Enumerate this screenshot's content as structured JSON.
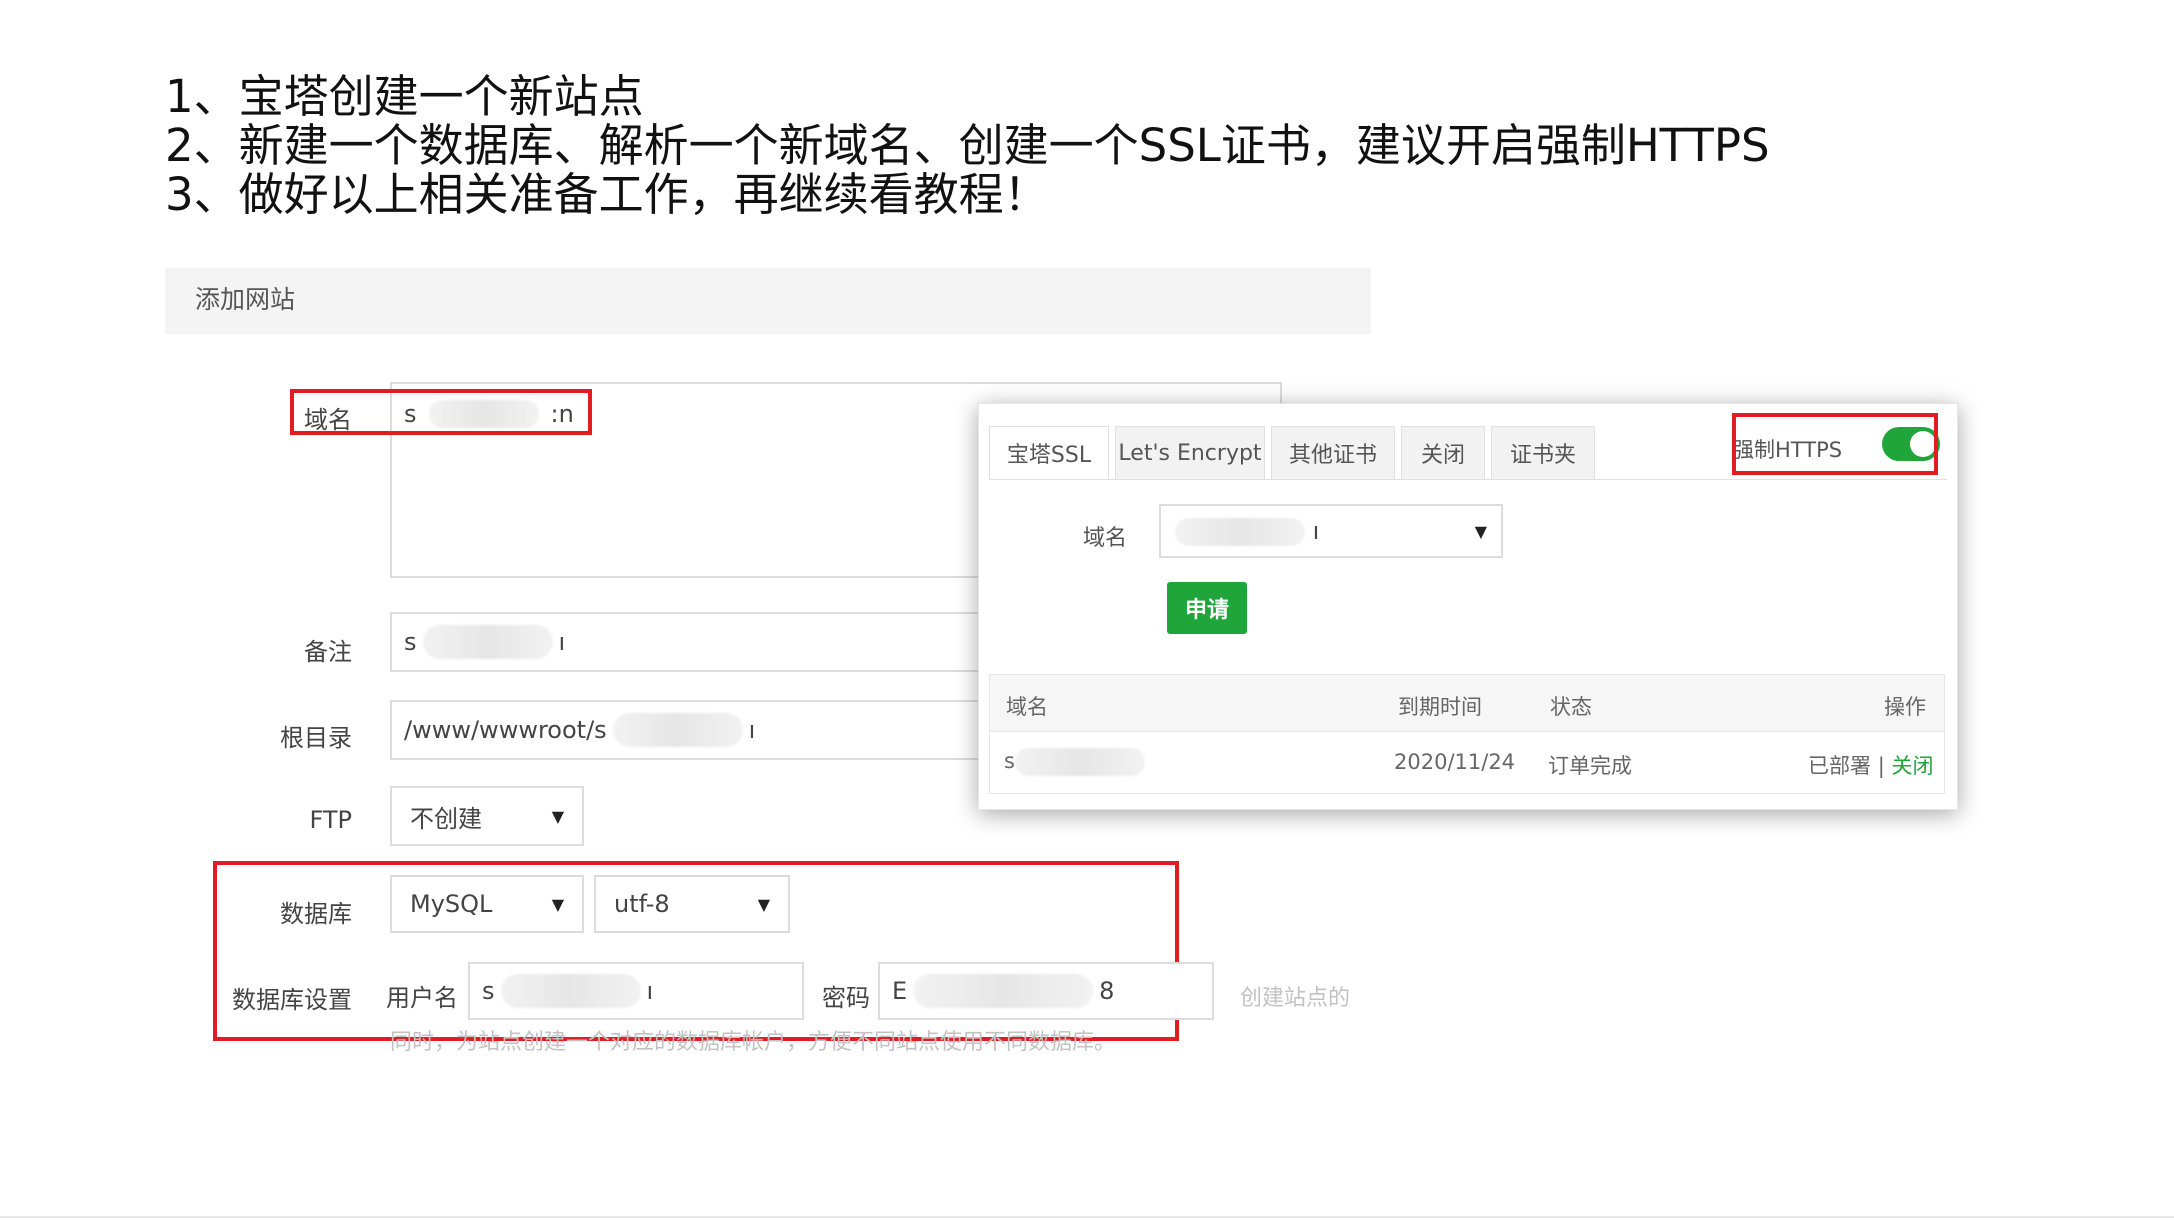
{
  "instructions": {
    "line1": "1、宝塔创建一个新站点",
    "line2": "2、新建一个数据库、解析一个新域名、创建一个SSL证书，建议开启强制HTTPS",
    "line3": "3、做好以上相关准备工作，再继续看教程！"
  },
  "add_site": {
    "title": "添加网站",
    "domain_label": "域名",
    "domain_value_start": "s",
    "domain_value_end": ":n",
    "remark_label": "备注",
    "remark_value_start": "s",
    "remark_value_end": "ı",
    "root_label": "根目录",
    "root_value": "/www/wwwroot/s",
    "root_value_end": "ı",
    "ftp_label": "FTP",
    "ftp_value": "不创建",
    "db_label": "数据库",
    "db_type": "MySQL",
    "db_charset": "utf-8",
    "db_settings_label": "数据库设置",
    "db_user_label": "用户名",
    "db_user_start": "s",
    "db_user_end": "ı",
    "db_pass_label": "密码",
    "db_pass_start": "E",
    "db_pass_end": "8",
    "hint_right": "创建站点的",
    "hint_below": "同时，为站点创建一个对应的数据库帐户，方便不同站点使用不同数据库。"
  },
  "ssl": {
    "tabs": [
      "宝塔SSL",
      "Let's Encrypt",
      "其他证书",
      "关闭",
      "证书夹"
    ],
    "force_https_label": "强制HTTPS",
    "force_https_on": true,
    "domain_label": "域名",
    "domain_select_end": "ı",
    "apply_button": "申请",
    "table": {
      "headers": [
        "域名",
        "到期时间",
        "状态",
        "操作"
      ],
      "row": {
        "domain_start": "s",
        "expiry": "2020/11/24",
        "status": "订单完成",
        "deployed": "已部署",
        "separator": "|",
        "close": "关闭"
      }
    }
  },
  "colors": {
    "accent_green": "#20a53a",
    "highlight_red": "#e31b23"
  }
}
